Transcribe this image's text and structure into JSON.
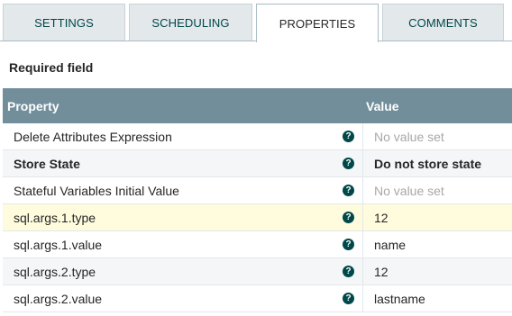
{
  "tabs": [
    {
      "label": "SETTINGS"
    },
    {
      "label": "SCHEDULING"
    },
    {
      "label": "PROPERTIES"
    },
    {
      "label": "COMMENTS"
    }
  ],
  "required_label": "Required field",
  "table": {
    "header_property": "Property",
    "header_value": "Value",
    "help_glyph": "?",
    "rows": [
      {
        "property": "Delete Attributes Expression",
        "value": "No value set"
      },
      {
        "property": "Store State",
        "value": "Do not store state"
      },
      {
        "property": "Stateful Variables Initial Value",
        "value": "No value set"
      },
      {
        "property": "sql.args.1.type",
        "value": "12"
      },
      {
        "property": "sql.args.1.value",
        "value": "name"
      },
      {
        "property": "sql.args.2.type",
        "value": "12"
      },
      {
        "property": "sql.args.2.value",
        "value": "lastname"
      }
    ]
  },
  "colors": {
    "header_bg": "#728e9b",
    "selected_row_bg": "#fffcde",
    "help_icon": "#004849",
    "unset_value": "#a8a8a8"
  },
  "icons": {
    "help": "help-circle-icon"
  }
}
